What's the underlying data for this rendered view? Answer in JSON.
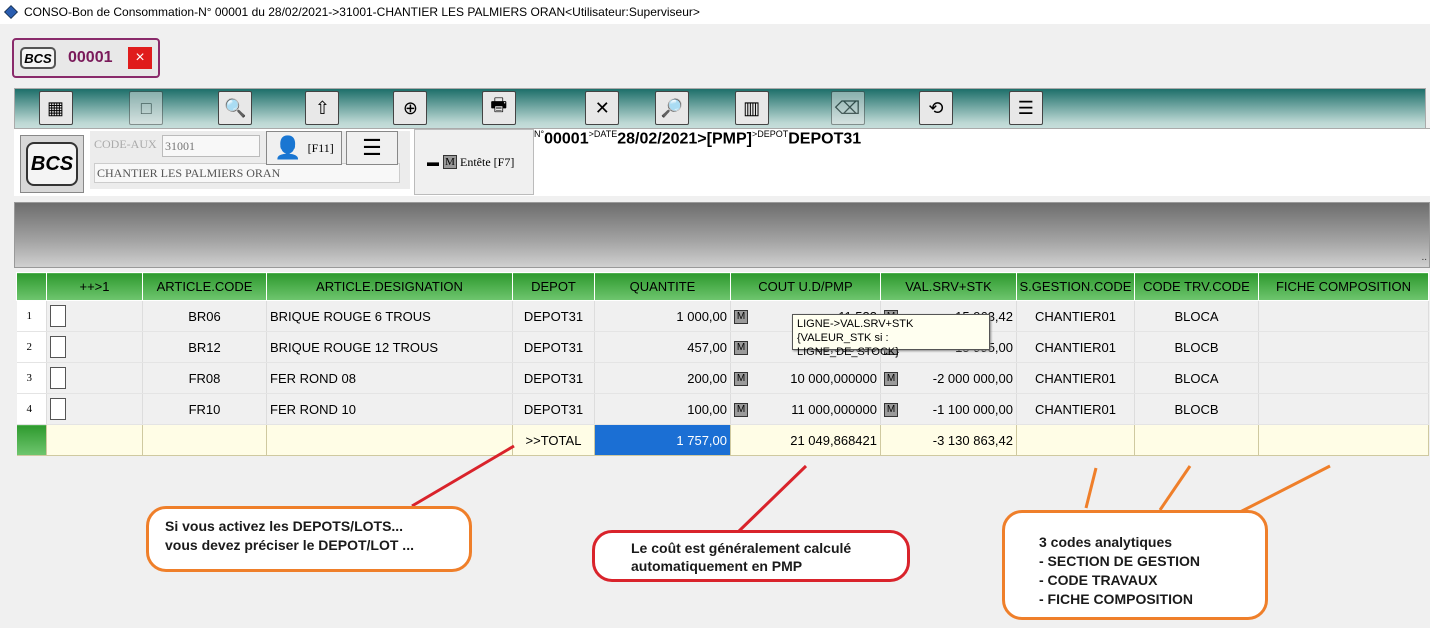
{
  "window": {
    "title": "CONSO-Bon de Consommation-N° 00001 du 28/02/2021->31001-CHANTIER LES PALMIERS ORAN<Utilisateur:Superviseur>"
  },
  "doc_tab": {
    "logo": "BCS",
    "number": "00001",
    "close": "×"
  },
  "toolbar": [
    {
      "label": "Art. [F12]",
      "icon": "grid-icon",
      "glyph": "▦",
      "enabled": true
    },
    {
      "label": "Valider",
      "icon": "validate-icon",
      "glyph": "□",
      "enabled": false
    },
    {
      "label": "Aperçu[F8]",
      "icon": "preview-icon",
      "glyph": "🔍",
      "enabled": true
    },
    {
      "label": "Ouvrir[F3]",
      "icon": "open-icon",
      "glyph": "⇧",
      "enabled": true
    },
    {
      "label": "Nouveau[F4]",
      "icon": "new-icon",
      "glyph": "⊕",
      "enabled": true
    },
    {
      "label": "Imprimer[F9]",
      "icon": "print-icon",
      "glyph": "🖶",
      "enabled": true
    },
    {
      "label": "Dévalider",
      "icon": "unvalidate-icon",
      "glyph": "✕",
      "enabled": true
    },
    {
      "label": "Lignes",
      "icon": "magnifier-icon",
      "glyph": "🔎",
      "enabled": true
    },
    {
      "label": "Pièces",
      "icon": "parts-icon",
      "glyph": "▥",
      "enabled": true
    },
    {
      "label": "Supprimer",
      "icon": "delete-icon",
      "glyph": "⌫",
      "enabled": false
    },
    {
      "label": "Convertir",
      "icon": "convert-icon",
      "glyph": "⟲",
      "enabled": true
    },
    {
      "label": "Menu+",
      "icon": "menu-plus-icon",
      "glyph": "☰",
      "enabled": true
    }
  ],
  "header": {
    "logo": "BCS",
    "aux_label": "CODE-AUX",
    "aux_code": "31001",
    "aux_name": "CHANTIER LES PALMIERS ORAN",
    "f11_label": "[F11]",
    "entete_label": "Entête [F7]",
    "m_label": "M",
    "n_prefix": "N°",
    "number": "00001",
    "date_prefix": ">DATE",
    "date": "28/02/2021",
    "method": ">[PMP]",
    "depot_prefix": ">DEPOT",
    "depot": "DEPOT31"
  },
  "banner_mark": "..",
  "grid": {
    "columns": [
      "",
      "++>1",
      "ARTICLE.CODE",
      "ARTICLE.DESIGNATION",
      "DEPOT",
      "QUANTITE",
      "COUT U.D/PMP",
      "VAL.SRV+STK",
      "S.GESTION.CODE",
      "CODE TRV.CODE",
      "FICHE COMPOSITION"
    ],
    "rows": [
      {
        "n": "1",
        "code": "BR06",
        "designation": "BRIQUE ROUGE 6 TROUS",
        "depot": "DEPOT31",
        "qty": "1 000,00",
        "cost": "11,533",
        "val": "-15 963,42",
        "sgestion": "CHANTIER01",
        "trv": "BLOCA",
        "fiche": ""
      },
      {
        "n": "2",
        "code": "BR12",
        "designation": "BRIQUE ROUGE 12 TROUS",
        "depot": "DEPOT31",
        "qty": "457,00",
        "cost": "35,000000",
        "val": "-15 995,00",
        "sgestion": "CHANTIER01",
        "trv": "BLOCB",
        "fiche": ""
      },
      {
        "n": "3",
        "code": "FR08",
        "designation": "FER ROND 08",
        "depot": "DEPOT31",
        "qty": "200,00",
        "cost": "10 000,000000",
        "val": "-2 000 000,00",
        "sgestion": "CHANTIER01",
        "trv": "BLOCA",
        "fiche": ""
      },
      {
        "n": "4",
        "code": "FR10",
        "designation": "FER ROND 10",
        "depot": "DEPOT31",
        "qty": "100,00",
        "cost": "11 000,000000",
        "val": "-1 100 000,00",
        "sgestion": "CHANTIER01",
        "trv": "BLOCB",
        "fiche": ""
      }
    ],
    "total": {
      "label": ">>TOTAL",
      "qty": "1 757,00",
      "cost": "21 049,868421",
      "val": "-3 130 863,42"
    },
    "m_label": "M"
  },
  "tooltip": {
    "line1": "LIGNE->VAL.SRV+STK",
    "line2": "{VALEUR_STK si :   LIGNE_DE_STOCK}"
  },
  "callouts": {
    "depot": [
      "Si vous activez les DEPOTS/LOTS...",
      "vous devez préciser le DEPOT/LOT ..."
    ],
    "cost": [
      "Le coût est généralement calculé",
      "automatiquement en PMP"
    ],
    "codes": [
      "3 codes analytiques",
      "- SECTION DE GESTION",
      "- CODE TRAVAUX",
      "- FICHE COMPOSITION"
    ]
  },
  "colors": {
    "grid_header": "#2e9a2e",
    "selected_cell": "#1b6fd4",
    "total_row": "#fffde6",
    "callout_orange": "#ef7f2a",
    "callout_red": "#d9232b",
    "doc_number": "#7a1a5a",
    "close_button": "#e01c1c"
  }
}
